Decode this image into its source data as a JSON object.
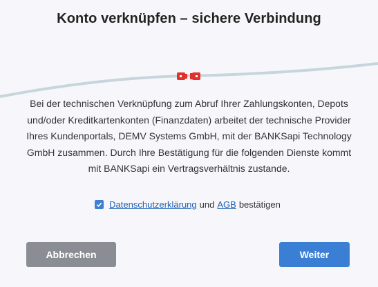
{
  "dialog": {
    "title": "Konto verknüpfen – sichere Verbindung",
    "description": "Bei der technischen Verknüpfung zum Abruf Ihrer Zahlungskonten, Depots und/oder Kreditkartenkonten (Finanzdaten) arbeitet der technische Provider Ihres Kundenportals, DEMV Systems GmbH, mit der BANKSapi Technology GmbH zusammen. Durch Ihre Bestätigung für die folgenden Dienste kommt mit BANKSapi ein Vertragsverhältnis zustande.",
    "consent": {
      "checked": true,
      "privacy_link": "Datenschutzerklärung",
      "and_text": "und",
      "terms_link": "AGB",
      "confirm_text": "bestätigen"
    },
    "cancel_label": "Abbrechen",
    "next_label": "Weiter"
  },
  "icons": {
    "connector": "plug-connector-icon",
    "check": "check-icon"
  },
  "colors": {
    "primary": "#3b7fd4",
    "cancel": "#8a8d94",
    "cable": "#c7d6dc",
    "plug": "#e0312b",
    "link": "#1f5fb0"
  }
}
